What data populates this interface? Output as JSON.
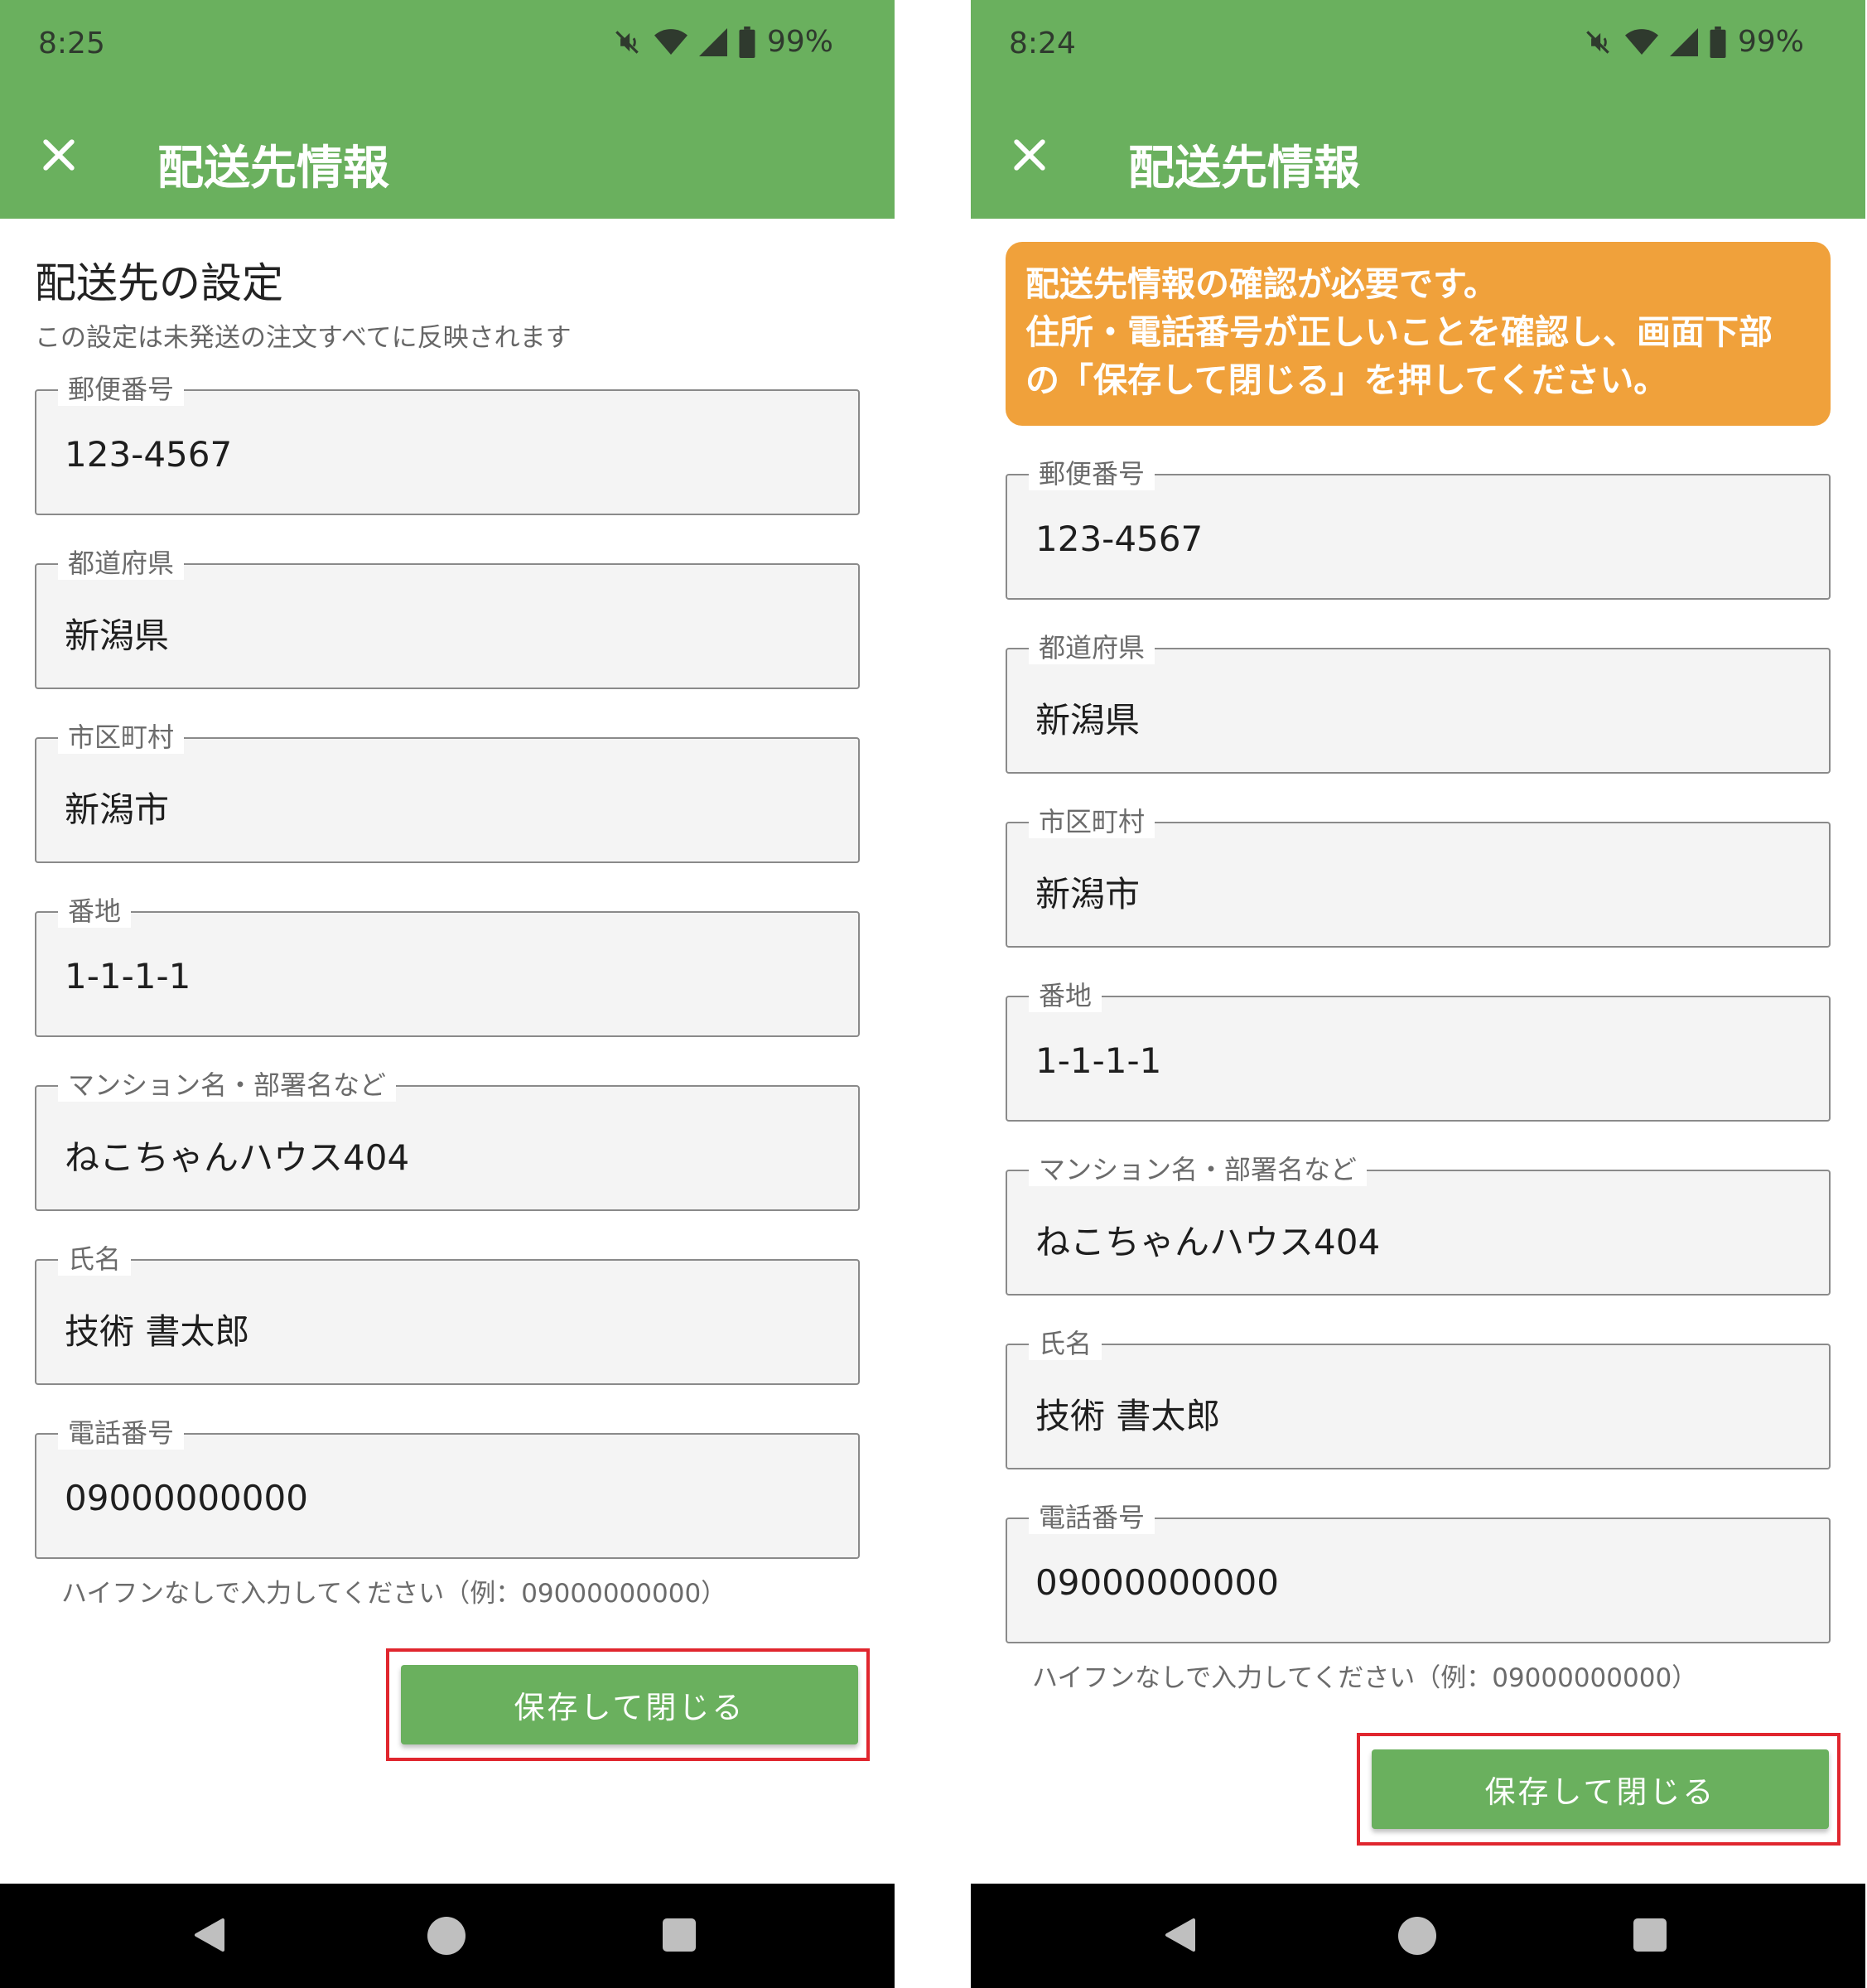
{
  "status_bar": {
    "left_time": "8:25",
    "right_time": "8:24",
    "battery": "99%"
  },
  "appbar": {
    "title": "配送先情報"
  },
  "left_panel": {
    "section_title": "配送先の設定",
    "section_subtitle": "この設定は未発送の注文すべてに反映されます"
  },
  "right_panel": {
    "alert_lines": [
      "配送先情報の確認が必要です。",
      "住所・電話番号が正しいことを確認し、画面下部",
      "の「保存して閉じる」を押してください。"
    ]
  },
  "fields": [
    {
      "label": "郵便番号",
      "value": "123-4567"
    },
    {
      "label": "都道府県",
      "value": "新潟県"
    },
    {
      "label": "市区町村",
      "value": "新潟市"
    },
    {
      "label": "番地",
      "value": "1-1-1-1"
    },
    {
      "label": "マンション名・部署名など",
      "value": "ねこちゃんハウス404"
    },
    {
      "label": "氏名",
      "value": "技術 書太郎"
    },
    {
      "label": "電話番号",
      "value": "09000000000"
    }
  ],
  "phone_helper": "ハイフンなしで入力してください（例：09000000000）",
  "save_button": "保存して閉じる",
  "icons": {
    "close": "close-icon",
    "mute": "mute-icon",
    "wifi": "wifi-icon",
    "signal": "signal-icon",
    "battery": "battery-icon",
    "back": "back-icon",
    "home": "home-icon",
    "recents": "recents-icon"
  },
  "colors": {
    "appbar": "#6ab05e",
    "alert": "#f0a13b",
    "highlight": "#e0262e",
    "navbar": "#000000"
  }
}
